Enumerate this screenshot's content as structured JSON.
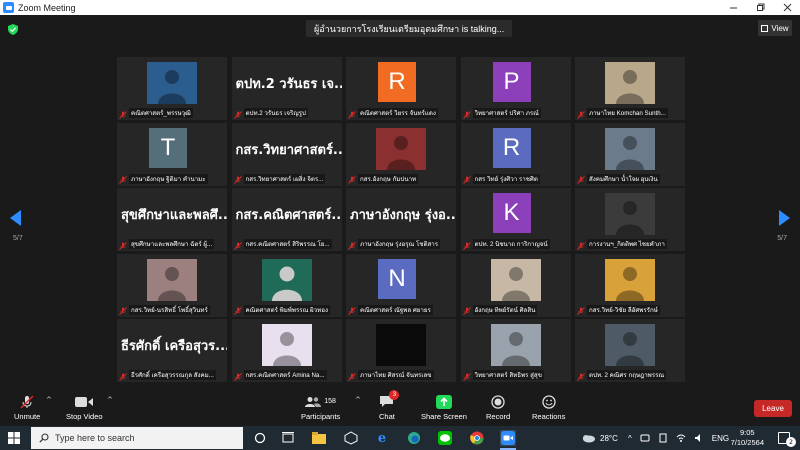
{
  "window": {
    "title": "Zoom Meeting",
    "controls": [
      "minimize",
      "restore",
      "close"
    ]
  },
  "meeting": {
    "talking_banner": "ผู้อำนวยการโรงเรียนเตรียมอุดมศึกษา is talking...",
    "view_label": "View",
    "page_left": "5/7",
    "page_right": "5/7",
    "tiles": [
      {
        "type": "photo",
        "name": "คณิตศาสตร์_พรรษวุฒิ",
        "photo_bg": "#2c5d8f"
      },
      {
        "type": "text",
        "big": "ตปท.2 วรันธร เจ...",
        "name": "ตปท.2 วรันธร เจริญรูป"
      },
      {
        "type": "avatar",
        "letter": "R",
        "color": "#f26b22",
        "name": "คณิตศาสตร์ วิยรร จันทร์แดง"
      },
      {
        "type": "avatar",
        "letter": "P",
        "color": "#8b3fb8",
        "name": "วิทยาศาสตร์ ปริศา ภรณ์"
      },
      {
        "type": "photo",
        "name": "ภาษาไทย Komchan Sunth...",
        "photo_bg": "#b9a78a"
      },
      {
        "type": "avatar",
        "letter": "T",
        "color": "#546e7a",
        "name": "ภาษาอังกฤษ ฐิติมา คำนามะ"
      },
      {
        "type": "text",
        "big": "กสร.วิทยาศาสตร์...",
        "name": "กสร.วิทยาศาสตร์ เผสิ่ง จิตร..."
      },
      {
        "type": "photo",
        "name": "กสร.อังกฤษ กัมปนาท",
        "photo_bg": "#8a3030"
      },
      {
        "type": "avatar",
        "letter": "R",
        "color": "#5b6bbf",
        "name": "กสร วิทย์ รุ่งศิวา ราชศิต"
      },
      {
        "type": "photo",
        "name": "สังคมศึกษา น้ำใจผ อุบเงิน",
        "photo_bg": "#6b7b8c"
      },
      {
        "type": "text",
        "big": "สุขศึกษาและพลศึ...",
        "name": "สุขศึกษาและพลศึกษา ฉัตร์ ผู้..."
      },
      {
        "type": "text",
        "big": "กสร.คณิตศาสตร์...",
        "name": "กสร.คณิตศาสตร์ สิริพรรณ โย..."
      },
      {
        "type": "text",
        "big": "ภาษาอังกฤษ รุ่งอ...",
        "name": "ภาษาอังกฤษ รุ่งอรุณ โชติสาร"
      },
      {
        "type": "avatar",
        "letter": "K",
        "color": "#8b3fb8",
        "name": "ตปท. 2 นิชนาถ การิกาญจน์"
      },
      {
        "type": "photo",
        "name": "การงานฯ_กิตติพศ ไชยคำภา",
        "photo_bg": "#3b3b3b"
      },
      {
        "type": "photo",
        "name": "กสร.วิทย์-นรสิทธิ์ โพธิ์สุวินทร์",
        "photo_bg": "#9c7f7f"
      },
      {
        "type": "person",
        "name": "คณิตศาสตร์ พิมพ์พรรณ ผิวทอง",
        "photo_bg": "#1f6b57"
      },
      {
        "type": "avatar",
        "letter": "N",
        "color": "#5b6bbf",
        "name": "คณิตศาสตร์ ณัฐพล ศยายร"
      },
      {
        "type": "photo",
        "name": "อังกฤษ ทิพย์รัตน์ ศิลสิน",
        "photo_bg": "#c7b8a6"
      },
      {
        "type": "photo",
        "name": "กสร.วิทย์-วิชัย ลีอัศพรรักษ์",
        "photo_bg": "#d9a13a"
      },
      {
        "type": "text",
        "big": "ธีรศักดิ์ เครือสุวร...",
        "name": "ธีรศักดิ์ เครือสุวรรณกุล สังคม..."
      },
      {
        "type": "photo",
        "name": "กสร.คณิตศาสตร์ Amina Na...",
        "photo_bg": "#e8e0ee"
      },
      {
        "type": "dark",
        "name": "ภาษาไทย ศิสรณ์ จันทรเลข",
        "photo_bg": "#0a0a0a"
      },
      {
        "type": "photo",
        "name": "วิทยาศาสตร์ สิทธิพร สู่สุข",
        "photo_bg": "#9aa3ad"
      },
      {
        "type": "photo",
        "name": "ตปท. 2 คณิศร กฤษฎาพรรณ",
        "photo_bg": "#4e5a66"
      }
    ]
  },
  "toolbar": {
    "unmute": "Unmute",
    "stop_video": "Stop Video",
    "participants": "Participants",
    "participants_count": "158",
    "chat": "Chat",
    "chat_badge": "3",
    "share_screen": "Share Screen",
    "record": "Record",
    "reactions": "Reactions",
    "leave": "Leave",
    "accent": "#2d8cff",
    "share_color": "#23d959",
    "leave_color": "#c62828"
  },
  "taskbar": {
    "search_placeholder": "Type here to search",
    "weather": "28°C",
    "language": "ENG",
    "time": "9:05",
    "date": "7/10/2564",
    "notification_count": "2"
  }
}
